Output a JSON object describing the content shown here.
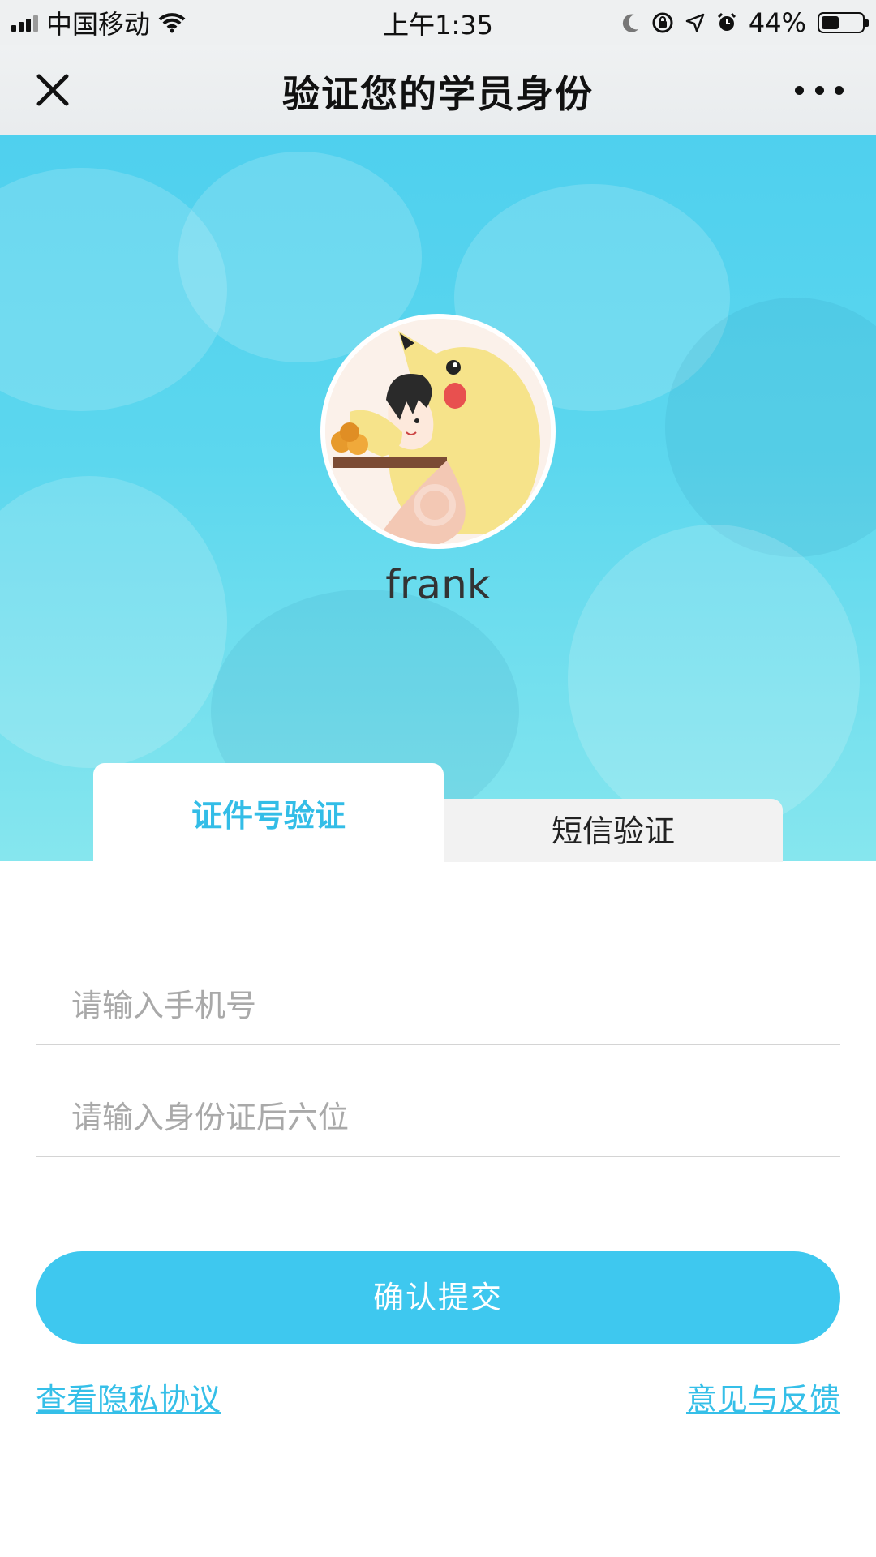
{
  "status_bar": {
    "carrier": "中国移动",
    "time": "上午1:35",
    "battery": "44%",
    "battery_level": 0.44,
    "icons": [
      "signal-icon",
      "wifi-icon",
      "moon-icon",
      "orientation-lock-icon",
      "location-icon",
      "alarm-icon",
      "battery-icon"
    ]
  },
  "nav": {
    "title": "验证您的学员身份",
    "close_icon": "close-icon",
    "more_icon": "more-icon"
  },
  "profile": {
    "username": "frank"
  },
  "tabs": [
    {
      "label": "证件号验证",
      "active": true
    },
    {
      "label": "短信验证",
      "active": false
    }
  ],
  "form": {
    "phone_placeholder": "请输入手机号",
    "phone_value": "",
    "id_placeholder": "请输入身份证后六位",
    "id_value": "",
    "submit_label": "确认提交"
  },
  "links": {
    "privacy": "查看隐私协议",
    "feedback": "意见与反馈"
  },
  "colors": {
    "accent": "#3ec8ef",
    "hero": "#5cd7ee",
    "active_tab_text": "#33bde7"
  }
}
